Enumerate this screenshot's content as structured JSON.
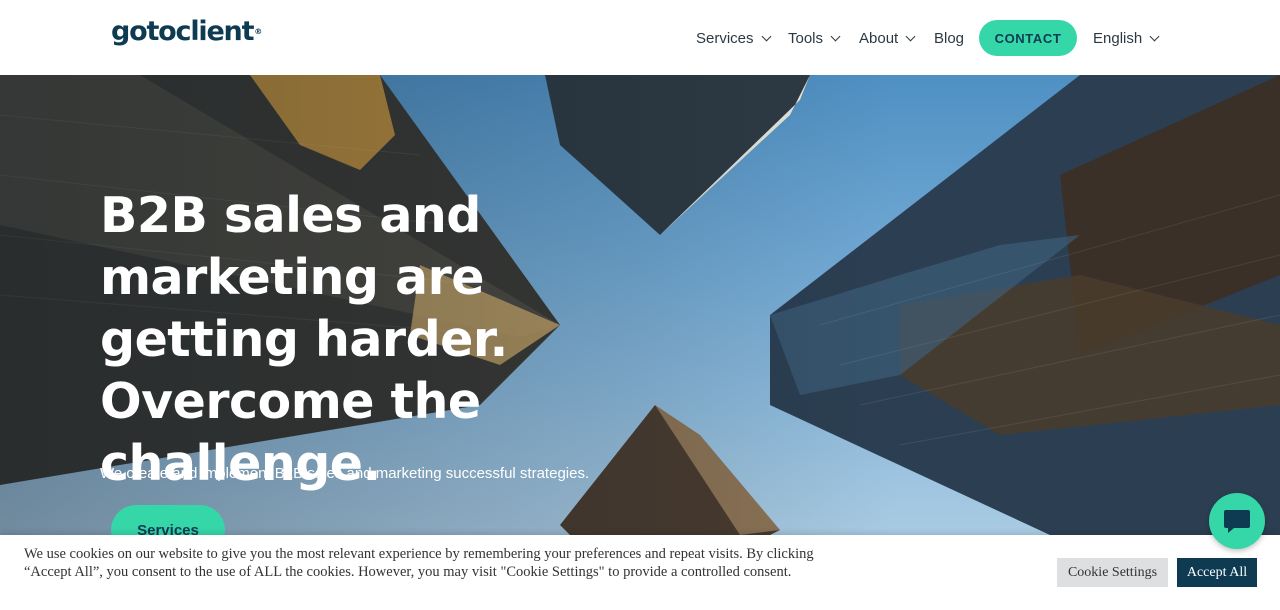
{
  "brand": {
    "logo_text": "gotoclient",
    "trademark": "®"
  },
  "nav": {
    "services": "Services",
    "tools": "Tools",
    "about": "About",
    "blog": "Blog",
    "contact": "CONTACT",
    "language": "English"
  },
  "hero": {
    "title": "B2B sales and marketing are getting harder. Overcome the challenge.",
    "subtitle": "We create and implement B2B sales and marketing successful strategies.",
    "cta_label": "Services"
  },
  "cookie": {
    "text": "We use cookies on our website to give you the most relevant experience by remembering your preferences and repeat visits. By clicking “Accept All”, you consent to the use of ALL the cookies. However, you may visit \"Cookie Settings\" to provide a controlled consent.",
    "settings_label": "Cookie Settings",
    "accept_label": "Accept All"
  },
  "chat": {
    "icon": "chat-bubble-icon"
  },
  "colors": {
    "accent": "#35d6a8",
    "brand_dark": "#0f3b52",
    "nav_text": "#2b3a42",
    "cookie_settings_bg": "#dedfe0"
  }
}
